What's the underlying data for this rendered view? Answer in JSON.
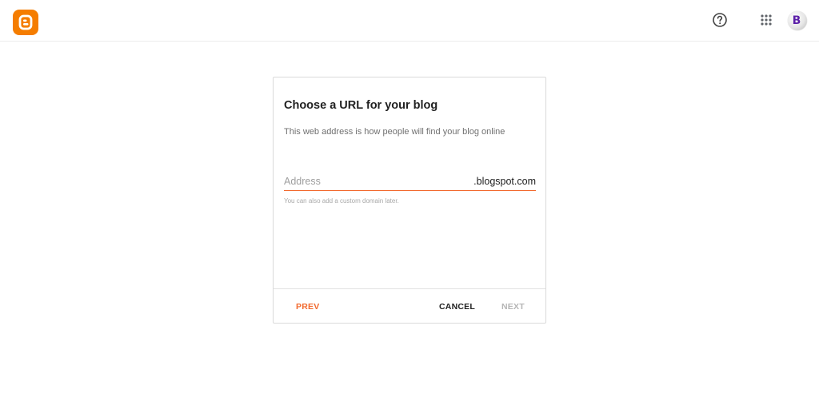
{
  "header": {
    "logo_icon": "blogger-logo-icon",
    "help_icon": "help-circle-icon",
    "apps_icon": "apps-grid-icon",
    "avatar_letter": "B",
    "brand_color": "#f57d00"
  },
  "dialog": {
    "title": "Choose a URL for your blog",
    "description": "This web address is how people will find your blog online",
    "address": {
      "value": "",
      "placeholder": "Address",
      "suffix": ".blogspot.com",
      "hint": "You can also add a custom domain later."
    },
    "buttons": {
      "prev": "PREV",
      "cancel": "CANCEL",
      "next": "NEXT"
    },
    "accent_color": "#f26a2e"
  }
}
